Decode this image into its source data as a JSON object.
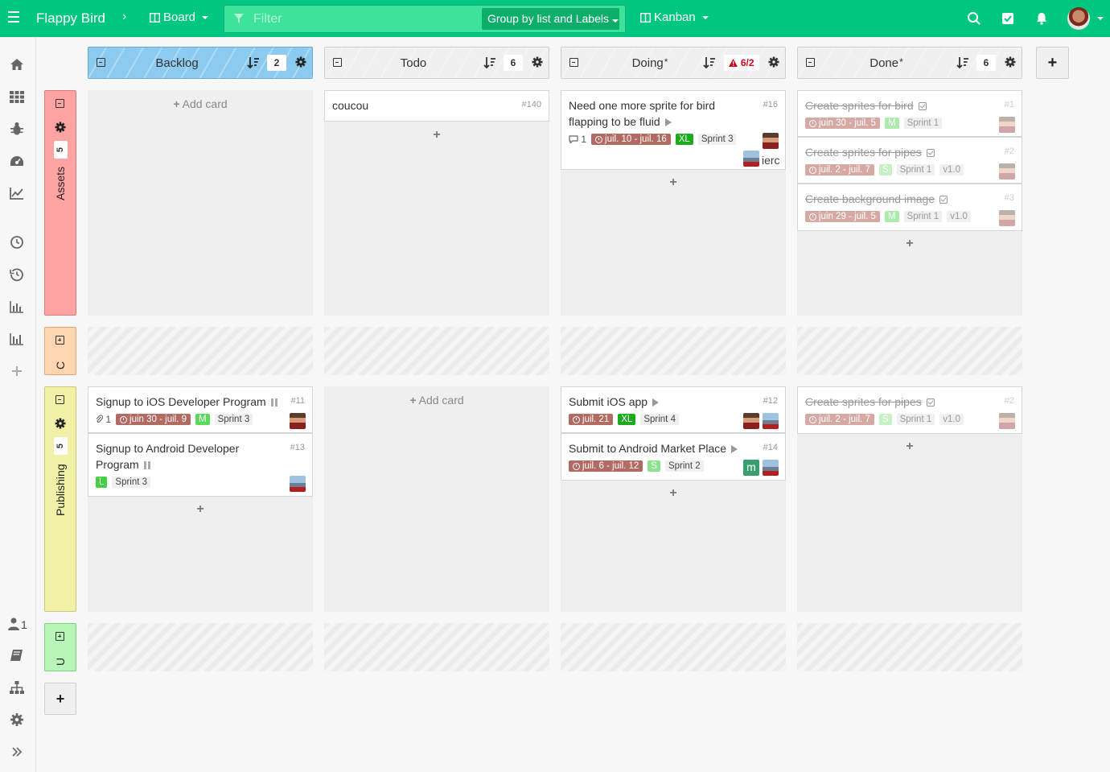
{
  "header": {
    "board_name": "Flappy Bird",
    "view_label": "Board",
    "filter_placeholder": "Filter",
    "group_by_label": "Group by list and Labels",
    "layout_label": "Kanban"
  },
  "colors": {
    "brand": "#00c77f",
    "lane_assets": "#ffa3a3",
    "lane_c": "#ffd4b0",
    "lane_publishing": "#f0f0a6",
    "lane_u": "#b8f5b8",
    "size_m": "#5bd95b",
    "size_xl": "#1daa1d",
    "size_s": "#8ee28e",
    "size_l": "#43d043",
    "date": "#b26b63"
  },
  "sidebar": {
    "icons": [
      "home-icon",
      "apps-grid-icon",
      "bug-icon",
      "dashboard-icon",
      "line-chart-icon",
      "clock-icon",
      "history-icon",
      "bar-chart-icon",
      "bar-chart-icon",
      "plus-icon"
    ],
    "bottom_icons": [
      "user-icon",
      "book-icon",
      "org-chart-icon",
      "gear-icon",
      "expand-icon"
    ],
    "user_count": "1"
  },
  "columns": [
    {
      "title": "Backlog",
      "star": "",
      "count": "2"
    },
    {
      "title": "Todo",
      "star": "",
      "count": "6"
    },
    {
      "title": "Doing",
      "star": "*",
      "count": "6/2"
    },
    {
      "title": "Done",
      "star": "*",
      "count": "6"
    }
  ],
  "swimlanes": [
    {
      "title": "Assets",
      "count": "5"
    },
    {
      "title": "C"
    },
    {
      "title": "Publishing",
      "count": "5"
    },
    {
      "title": "U"
    }
  ],
  "add_card_label": "Add card",
  "add_plus": "+",
  "cards": {
    "todo_assets": {
      "title": "coucou",
      "number": "#140"
    },
    "doing_assets": {
      "title": "Need one more sprite for bird flapping to be fluid",
      "number": "#16",
      "comments": "1",
      "date": "juil. 10 - juil. 16",
      "size": "XL",
      "sprint": "Sprint 3",
      "extra": "ierc"
    },
    "done_1": {
      "title": "Create sprites for bird",
      "number": "#1",
      "date": "juin 30 - juil. 5",
      "size": "M",
      "sprint": "Sprint 1"
    },
    "done_2": {
      "title": "Create sprites for pipes",
      "number": "#2",
      "date": "juil. 2 - juil. 7",
      "size": "S",
      "sprint": "Sprint 1",
      "version": "v1.0"
    },
    "done_3": {
      "title": "Create background image",
      "number": "#3",
      "date": "juin 29 - juil. 5",
      "size": "M",
      "sprint": "Sprint 1",
      "version": "v1.0"
    },
    "backlog_pub_1": {
      "title": "Signup to iOS Developer Program",
      "number": "#11",
      "attachments": "1",
      "date": "juin 30 - juil. 9",
      "size": "M",
      "sprint": "Sprint 3"
    },
    "backlog_pub_2": {
      "title": "Signup to Android Developer Program",
      "number": "#13",
      "size": "L",
      "sprint": "Sprint 3"
    },
    "doing_pub_1": {
      "title": "Submit iOS app",
      "number": "#12",
      "date": "juil. 21",
      "size": "XL",
      "sprint": "Sprint 4"
    },
    "doing_pub_2": {
      "title": "Submit to Android Market Place",
      "number": "#14",
      "date": "juil. 6 - juil. 12",
      "size": "S",
      "sprint": "Sprint 2",
      "member_initial": "m"
    },
    "done_pub_1": {
      "title": "Create sprites for pipes",
      "number": "#2",
      "date": "juil. 2 - juil. 7",
      "size": "S",
      "sprint": "Sprint 1",
      "version": "v1.0"
    }
  }
}
